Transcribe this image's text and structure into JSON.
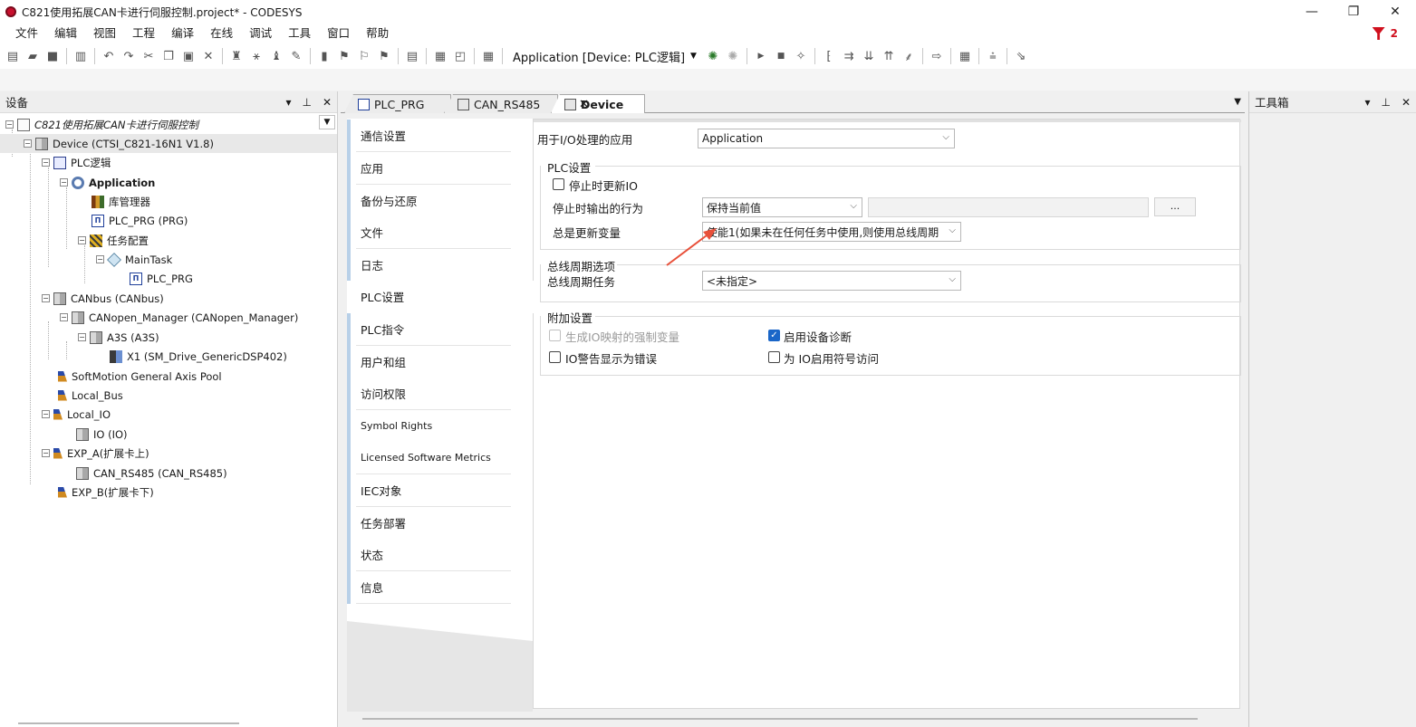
{
  "window": {
    "title": "C821使用拓展CAN卡进行伺服控制.project* - CODESYS",
    "controls": [
      "—",
      "❐",
      "✕"
    ]
  },
  "menu": {
    "items": [
      "文件",
      "编辑",
      "视图",
      "工程",
      "编译",
      "在线",
      "调试",
      "工具",
      "窗口",
      "帮助"
    ],
    "badge_count": "2"
  },
  "toolbar": {
    "application_combo": "Application [Device: PLC逻辑]"
  },
  "devices_panel": {
    "title": "设备",
    "tree": [
      {
        "label": "C821使用拓展CAN卡进行伺服控制",
        "italic": true
      },
      {
        "label": "Device (CTSI_C821-16N1 V1.8)"
      },
      {
        "label": "PLC逻辑"
      },
      {
        "label": "Application",
        "bold": true
      },
      {
        "label": "库管理器"
      },
      {
        "label": "PLC_PRG (PRG)"
      },
      {
        "label": "任务配置"
      },
      {
        "label": "MainTask"
      },
      {
        "label": "PLC_PRG"
      },
      {
        "label": "CANbus (CANbus)"
      },
      {
        "label": "CANopen_Manager (CANopen_Manager)"
      },
      {
        "label": "A3S (A3S)"
      },
      {
        "label": "X1 (SM_Drive_GenericDSP402)"
      },
      {
        "label": "SoftMotion General Axis Pool"
      },
      {
        "label": "Local_Bus"
      },
      {
        "label": "Local_IO"
      },
      {
        "label": "IO (IO)"
      },
      {
        "label": "EXP_A(扩展卡上)"
      },
      {
        "label": "CAN_RS485 (CAN_RS485)"
      },
      {
        "label": "EXP_B(扩展卡下)"
      }
    ]
  },
  "editor": {
    "tabs": [
      {
        "label": "PLC_PRG"
      },
      {
        "label": "CAN_RS485"
      },
      {
        "label": "Device",
        "close": "✕"
      }
    ],
    "nav": [
      "通信设置",
      "应用",
      "备份与还原",
      "文件",
      "日志",
      "PLC设置",
      "PLC指令",
      "用户和组",
      "访问权限",
      "Symbol Rights",
      "Licensed Software Metrics",
      "IEC对象",
      "任务部署",
      "状态",
      "信息"
    ],
    "plc_settings": {
      "io_app_label": "用于I/O处理的应用",
      "io_app_value": "Application",
      "group_plc": "PLC设置",
      "update_io_on_stop": "停止时更新IO",
      "output_behavior_label": "停止时输出的行为",
      "output_behavior_value": "保持当前值",
      "ellipsis": "...",
      "always_update_label": "总是更新变量",
      "always_update_value": "使能1(如果未在任何任务中使用,则使用总线周期",
      "group_bus": "总线周期选项",
      "bus_task_label": "总线周期任务",
      "bus_task_value": "<未指定>",
      "group_extra": "附加设置",
      "forced_vars": "生成IO映射的强制变量",
      "enable_diag": "启用设备诊断",
      "io_warnings": "IO警告显示为错误",
      "symbol_access": "为 IO启用符号访问"
    }
  },
  "toolbox_panel": {
    "title": "工具箱"
  },
  "colors": {
    "accent": "#1a66c8",
    "arrow": "#e8503a"
  }
}
